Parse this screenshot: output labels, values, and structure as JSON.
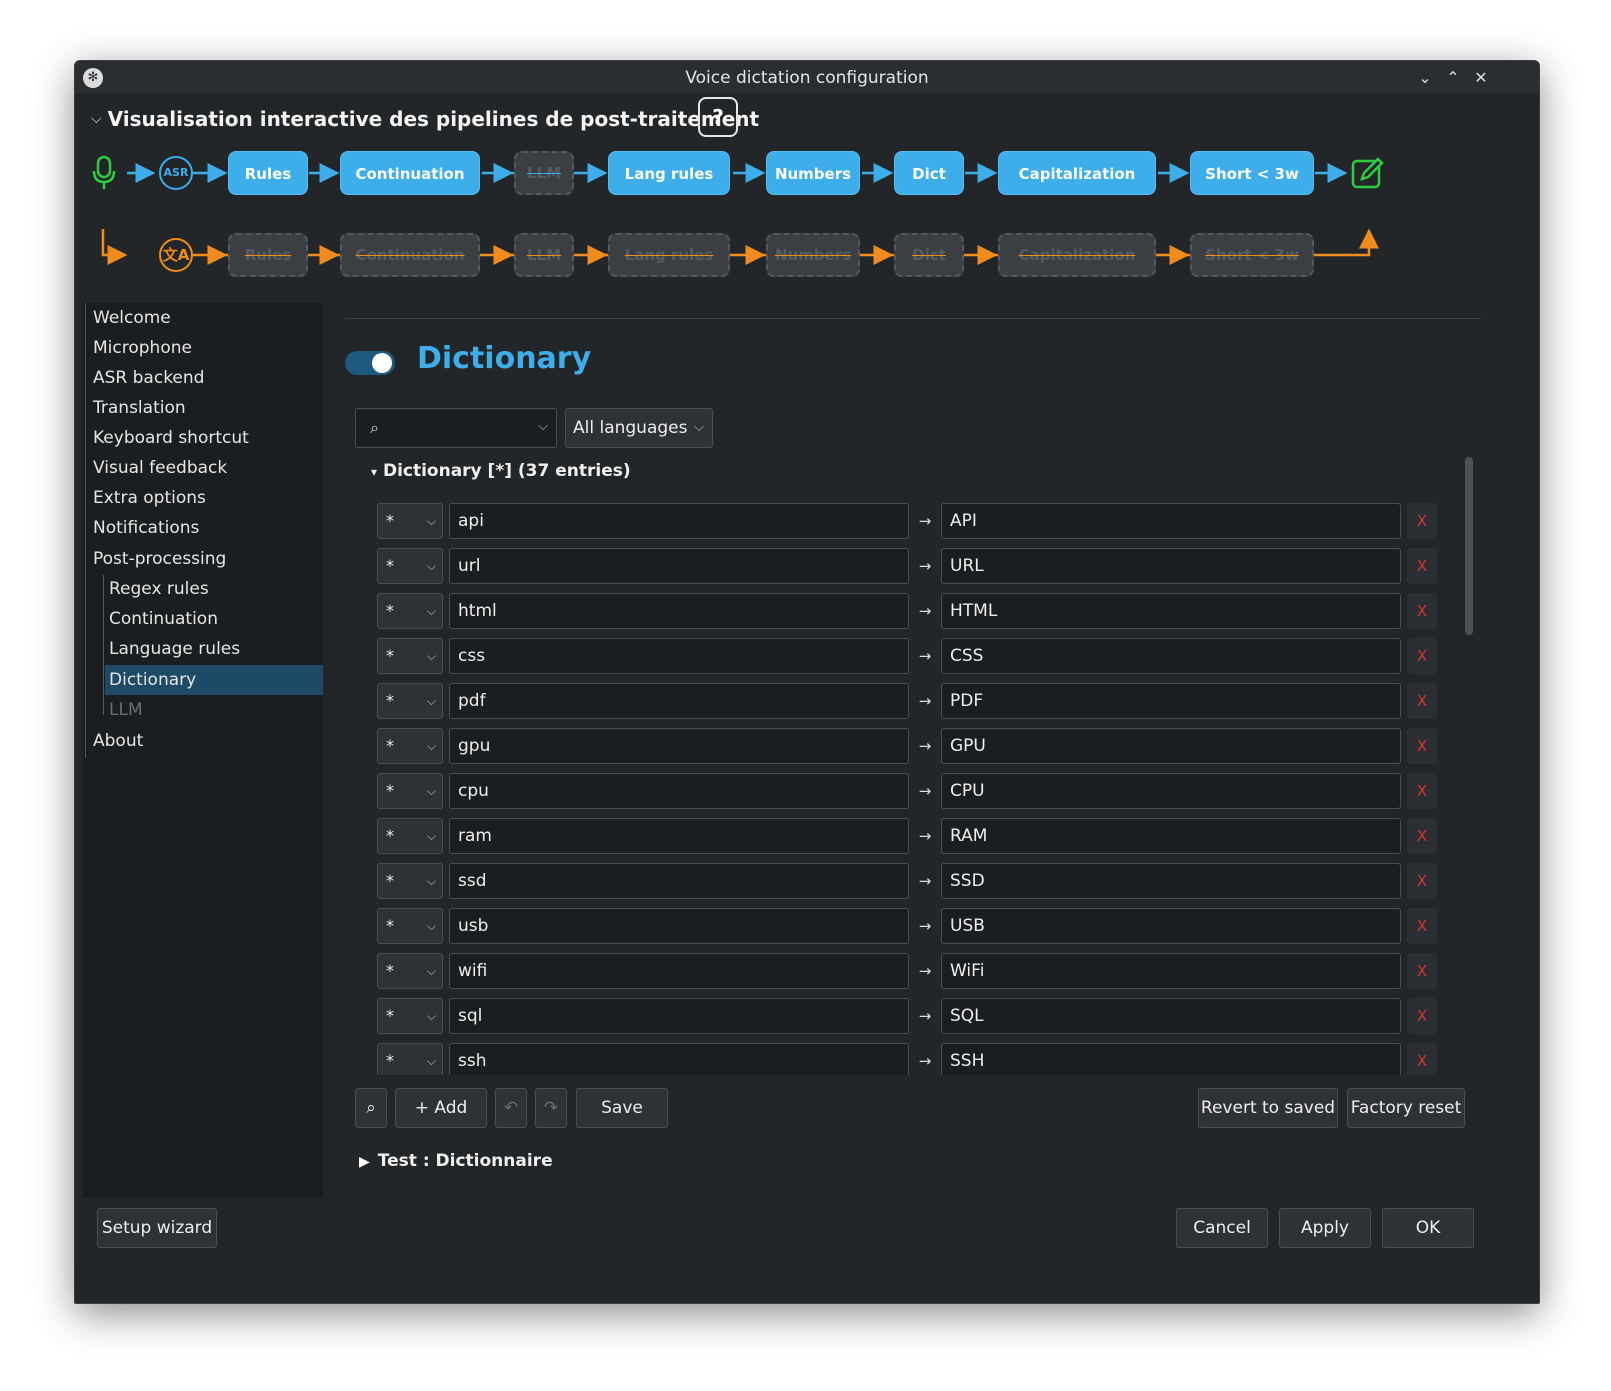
{
  "window": {
    "title": "Voice dictation configuration"
  },
  "pipeline": {
    "title": "Visualisation interactive des pipelines de post-traitement",
    "help_label": "?",
    "asr_label": "ASR",
    "translate_label": "文A",
    "main_nodes": [
      {
        "label": "Rules",
        "active": true
      },
      {
        "label": "Continuation",
        "active": true
      },
      {
        "label": "LLM",
        "active": false
      },
      {
        "label": "Lang rules",
        "active": true
      },
      {
        "label": "Numbers",
        "active": true
      },
      {
        "label": "Dict",
        "active": true
      },
      {
        "label": "Capitalization",
        "active": true
      },
      {
        "label": "Short < 3w",
        "active": true
      }
    ],
    "translation_nodes": [
      {
        "label": "Rules",
        "active": false
      },
      {
        "label": "Continuation",
        "active": false
      },
      {
        "label": "LLM",
        "active": false
      },
      {
        "label": "Lang rules",
        "active": false
      },
      {
        "label": "Numbers",
        "active": false
      },
      {
        "label": "Dict",
        "active": false
      },
      {
        "label": "Capitalization",
        "active": false
      },
      {
        "label": "Short < 3w",
        "active": false
      }
    ],
    "colors": {
      "main": "#3daee9",
      "translation": "#f08c1e",
      "output": "#2ecc40"
    }
  },
  "sidebar": {
    "items": [
      {
        "label": "Welcome",
        "level": 0
      },
      {
        "label": "Microphone",
        "level": 0
      },
      {
        "label": "ASR backend",
        "level": 0
      },
      {
        "label": "Translation",
        "level": 0
      },
      {
        "label": "Keyboard shortcut",
        "level": 0
      },
      {
        "label": "Visual feedback",
        "level": 0
      },
      {
        "label": "Extra options",
        "level": 0
      },
      {
        "label": "Notifications",
        "level": 0
      },
      {
        "label": "Post-processing",
        "level": 0
      },
      {
        "label": "Regex rules",
        "level": 1
      },
      {
        "label": "Continuation",
        "level": 1
      },
      {
        "label": "Language rules",
        "level": 1
      },
      {
        "label": "Dictionary",
        "level": 1
      },
      {
        "label": "LLM",
        "level": 1
      },
      {
        "label": "About",
        "level": 0
      }
    ],
    "selected": "Dictionary"
  },
  "dictionary": {
    "title": "Dictionary",
    "enabled": true,
    "search_value": "",
    "language_filter": "All languages",
    "header": "Dictionary [*] (37 entries)",
    "arrow": "→",
    "delete_label": "X",
    "entries": [
      {
        "lang": "*",
        "src": "api",
        "dst": "API"
      },
      {
        "lang": "*",
        "src": "url",
        "dst": "URL"
      },
      {
        "lang": "*",
        "src": "html",
        "dst": "HTML"
      },
      {
        "lang": "*",
        "src": "css",
        "dst": "CSS"
      },
      {
        "lang": "*",
        "src": "pdf",
        "dst": "PDF"
      },
      {
        "lang": "*",
        "src": "gpu",
        "dst": "GPU"
      },
      {
        "lang": "*",
        "src": "cpu",
        "dst": "CPU"
      },
      {
        "lang": "*",
        "src": "ram",
        "dst": "RAM"
      },
      {
        "lang": "*",
        "src": "ssd",
        "dst": "SSD"
      },
      {
        "lang": "*",
        "src": "usb",
        "dst": "USB"
      },
      {
        "lang": "*",
        "src": "wifi",
        "dst": "WiFi"
      },
      {
        "lang": "*",
        "src": "sql",
        "dst": "SQL"
      },
      {
        "lang": "*",
        "src": "ssh",
        "dst": "SSH"
      }
    ],
    "toolbar": {
      "add": "+ Add",
      "save": "Save",
      "revert": "Revert to saved",
      "factory": "Factory reset"
    },
    "test_section": "Test : Dictionnaire"
  },
  "footer": {
    "setup_wizard": "Setup wizard",
    "cancel": "Cancel",
    "apply": "Apply",
    "ok": "OK"
  }
}
